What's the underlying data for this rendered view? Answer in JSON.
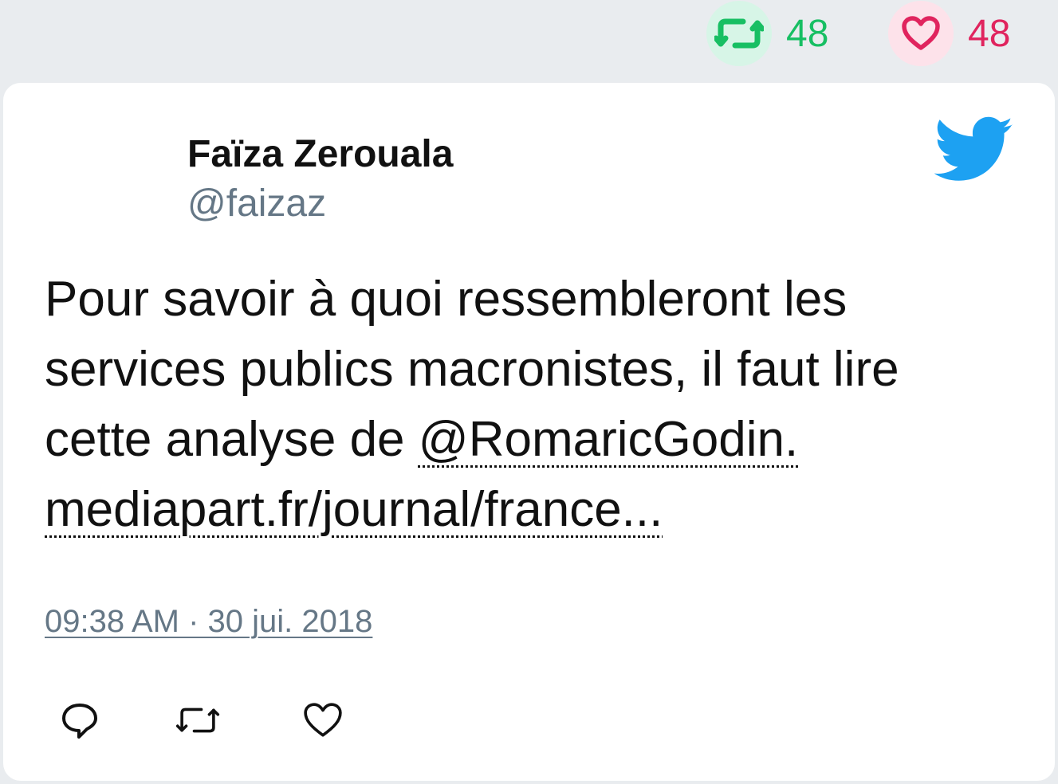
{
  "stats": {
    "retweet_count": "48",
    "like_count": "48"
  },
  "author": {
    "name": "Faïza Zerouala",
    "handle": "@faizaz"
  },
  "tweet": {
    "text_part1": "Pour savoir à quoi ressembleront les services publics macronistes, il faut lire cette analyse de ",
    "mention": "@RomaricGodin.",
    "url": "mediapart.fr/journal/france...",
    "timestamp": "09:38 AM · 30 jui. 2018"
  },
  "colors": {
    "retweet_green": "#17bf63",
    "like_red": "#e0245e",
    "twitter_blue": "#1da1f2",
    "muted_gray": "#657786",
    "page_bg": "#e9ecef"
  },
  "icons": {
    "retweet": "retweet-icon",
    "like": "heart-icon",
    "reply": "reply-icon",
    "brand": "twitter-bird-icon"
  }
}
